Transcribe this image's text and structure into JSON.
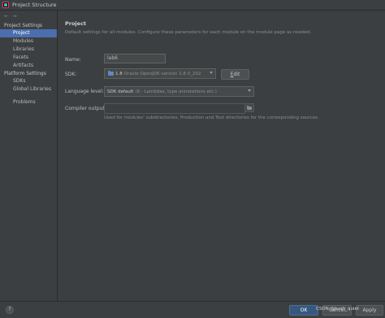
{
  "window": {
    "title": "Project Structure"
  },
  "nav": {
    "back": "←",
    "forward": "→"
  },
  "sidebar": {
    "project_settings_title": "Project Settings",
    "project_items": [
      {
        "label": "Project"
      },
      {
        "label": "Modules"
      },
      {
        "label": "Libraries"
      },
      {
        "label": "Facets"
      },
      {
        "label": "Artifacts"
      }
    ],
    "platform_settings_title": "Platform Settings",
    "platform_items": [
      {
        "label": "SDKs"
      },
      {
        "label": "Global Libraries"
      }
    ],
    "problems_label": "Problems"
  },
  "main": {
    "heading": "Project",
    "description": "Default settings for all modules. Configure these parameters for each module on the module page as needed.",
    "name_label": "Name:",
    "name_value": "lab6",
    "sdk_label": "SDK:",
    "sdk_version": "1.8",
    "sdk_detail": "Oracle OpenJDK version 1.8.0_202",
    "edit_button_mnemonic": "E",
    "edit_button_rest": "dit",
    "language_level_label": "Language level:",
    "language_level_value": "SDK default",
    "language_level_detail": "(8 - Lambdas, type annotations etc.)",
    "compiler_output_label": "Compiler output:",
    "compiler_output_value": "",
    "compiler_output_hint": "Used for modules' subdirectories, Production and Test directories for the corresponding sources."
  },
  "footer": {
    "help_label": "?",
    "ok_label": "OK",
    "cancel_label": "Cancel",
    "apply_label": "Apply",
    "watermark": "CSDN @hush_quiet"
  },
  "colors": {
    "background": "#3c3f41",
    "selection": "#4b6eaf",
    "ok_button": "#365880"
  }
}
